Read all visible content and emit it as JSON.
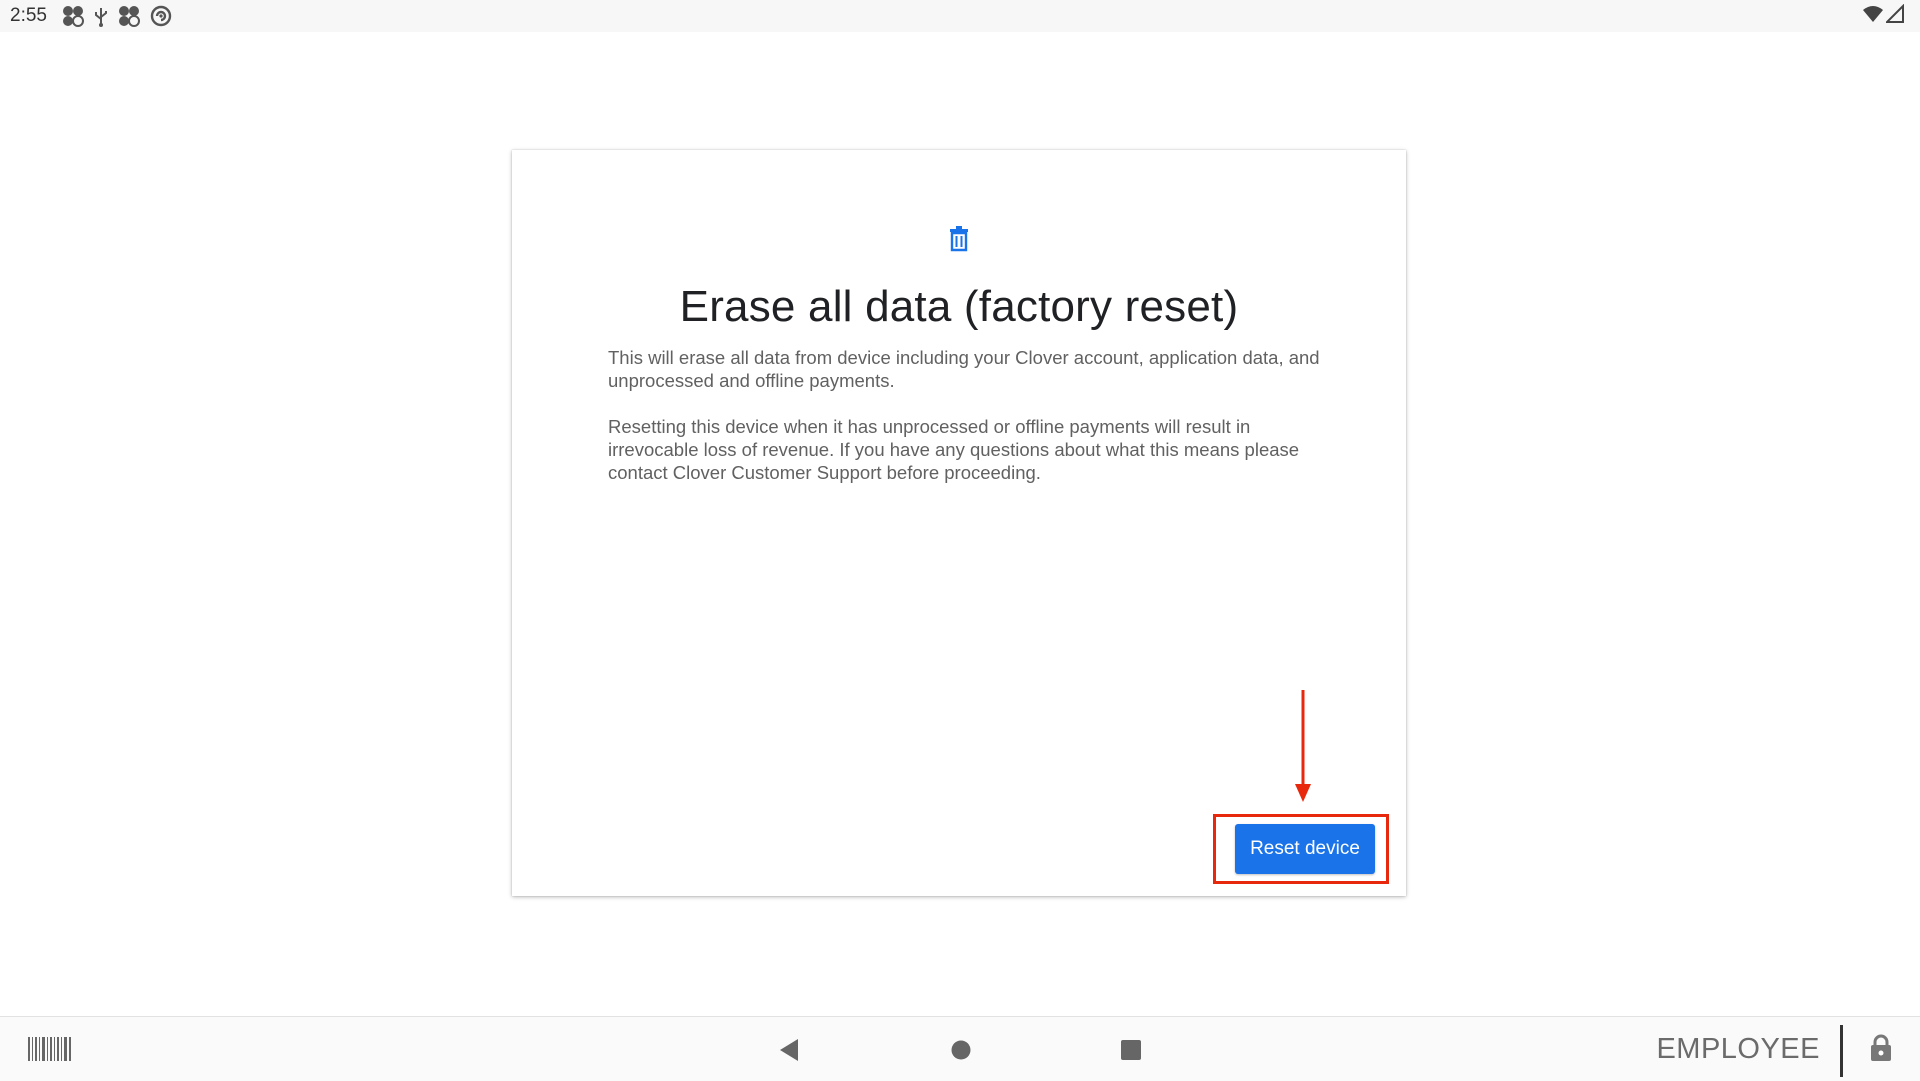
{
  "status_bar": {
    "time": "2:55",
    "icons": [
      "clover-app-icon",
      "usb-icon",
      "clover-app-icon",
      "sync-icon"
    ],
    "right_icons": [
      "wifi-icon",
      "signal-icon"
    ]
  },
  "dialog": {
    "icon": "trash-icon",
    "title": "Erase all data (factory reset)",
    "paragraph1": "This will erase all data from device including your Clover account, application data, and unprocessed and offline payments.",
    "paragraph2": "Resetting this device when it has unprocessed or offline payments will result in irrevocable loss of revenue. If you have any questions about what this means please contact Clover Customer Support before proceeding.",
    "reset_button_label": "Reset device"
  },
  "annotation": {
    "highlight_color": "#e8280c"
  },
  "nav_bar": {
    "employee_label": "EMPLOYEE",
    "left_icon": "barcode-icon",
    "right_icon": "lock-icon"
  },
  "colors": {
    "accent": "#1a73e8",
    "title_text": "#202124",
    "body_text": "#616161"
  }
}
